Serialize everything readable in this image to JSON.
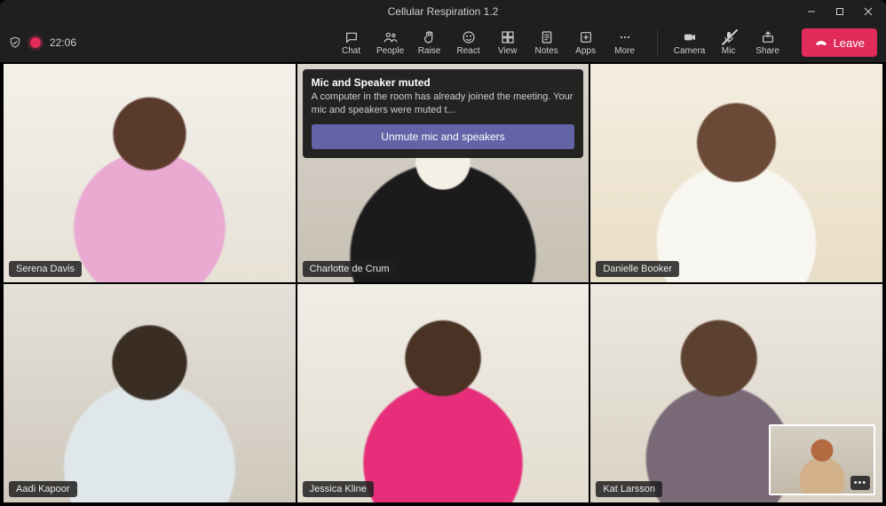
{
  "window": {
    "title": "Cellular Respiration 1.2"
  },
  "meeting": {
    "elapsed": "22:06"
  },
  "toolbar": {
    "chat": "Chat",
    "people": "People",
    "raise": "Raise",
    "react": "React",
    "view": "View",
    "notes": "Notes",
    "apps": "Apps",
    "more": "More",
    "camera": "Camera",
    "mic": "Mic",
    "share": "Share",
    "leave": "Leave"
  },
  "notification": {
    "title": "Mic and Speaker muted",
    "body": "A computer in the room has already joined the meeting. Your mic and speakers were muted t...",
    "action": "Unmute mic and speakers"
  },
  "participants": [
    {
      "name": "Serena Davis"
    },
    {
      "name": "Charlotte de Crum"
    },
    {
      "name": "Danielle Booker"
    },
    {
      "name": "Aadi Kapoor"
    },
    {
      "name": "Jessica Kline"
    },
    {
      "name": "Kat Larsson"
    }
  ],
  "pip_more": "•••"
}
